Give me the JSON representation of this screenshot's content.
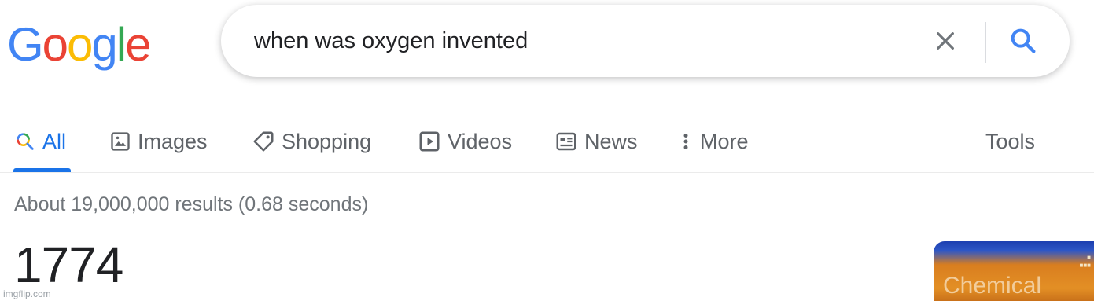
{
  "logo": {
    "letters": [
      "G",
      "o",
      "o",
      "g",
      "l",
      "e"
    ],
    "colors": [
      "#4285f4",
      "#ea4335",
      "#fbbc05",
      "#4285f4",
      "#34a853",
      "#ea4335"
    ]
  },
  "search": {
    "query": "when was oxygen invented"
  },
  "tabs": [
    {
      "label": "All",
      "icon": "search-icon"
    },
    {
      "label": "Images",
      "icon": "image-icon"
    },
    {
      "label": "Shopping",
      "icon": "tag-icon"
    },
    {
      "label": "Videos",
      "icon": "play-icon"
    },
    {
      "label": "News",
      "icon": "news-icon"
    },
    {
      "label": "More",
      "icon": "more-vertical-icon"
    }
  ],
  "tools_label": "Tools",
  "results": {
    "stats": "About 19,000,000 results (0.68 seconds)",
    "answer": "1774"
  },
  "thumbnail": {
    "title": "Chemical"
  },
  "watermark": "imgflip.com",
  "colors": {
    "accent": "#1a73e8",
    "muted": "#5f6368"
  }
}
